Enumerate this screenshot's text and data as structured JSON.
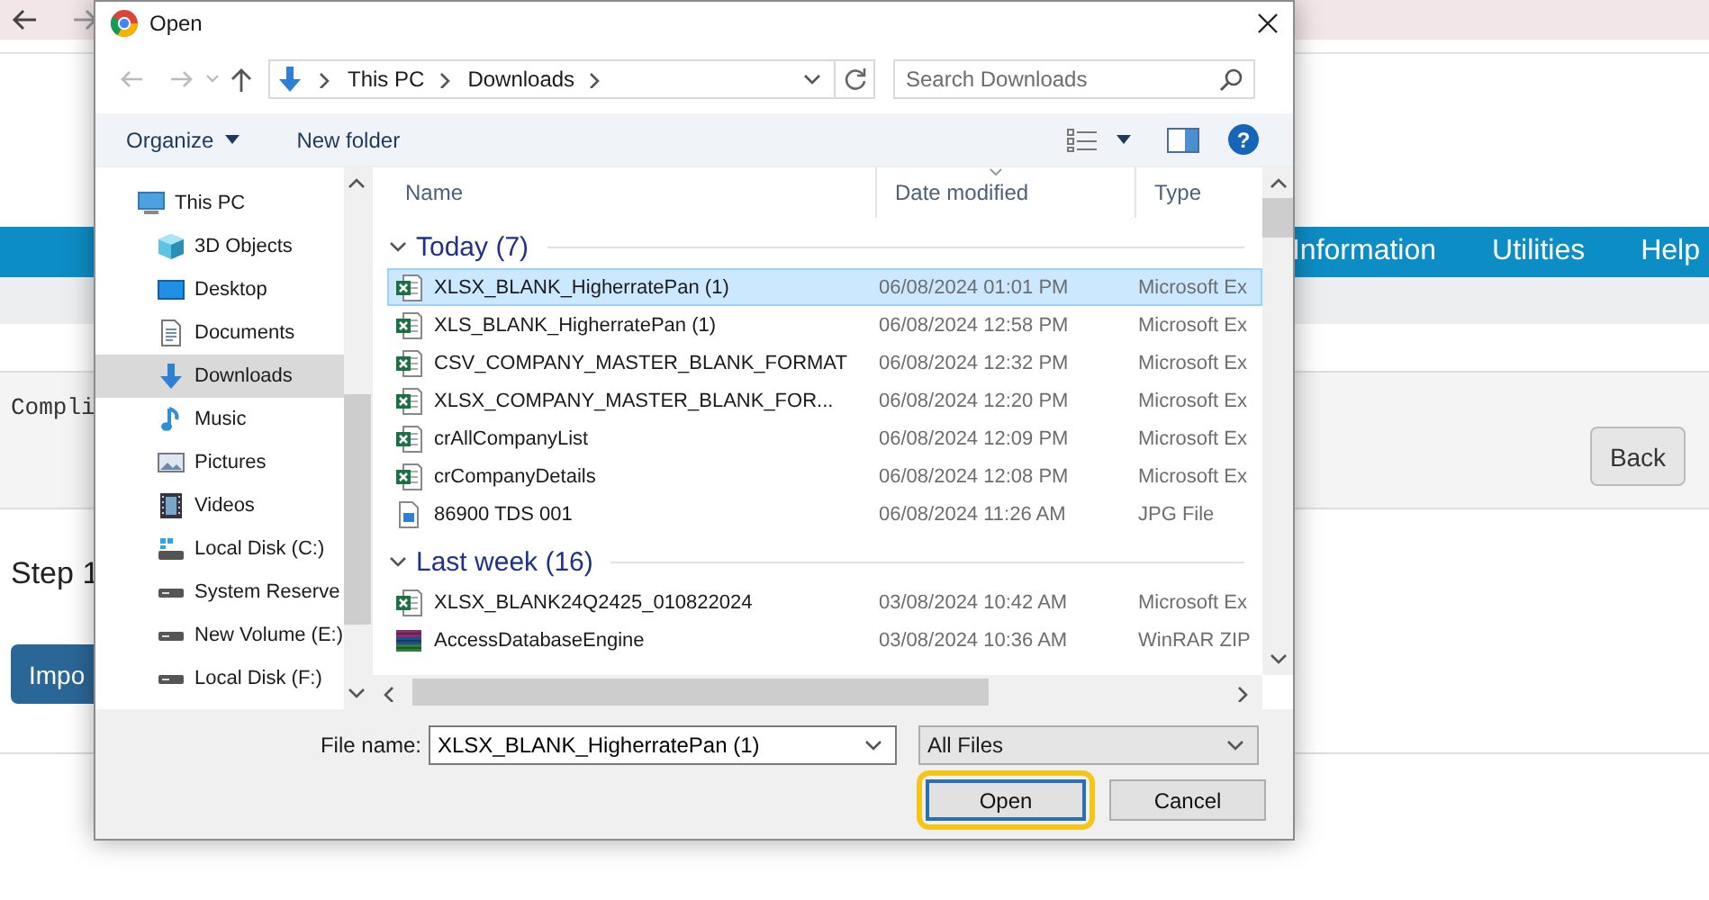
{
  "page": {
    "nav_menu": [
      {
        "label": "Information"
      },
      {
        "label": "Utilities"
      },
      {
        "label": "Help"
      }
    ],
    "panel_text": "Compli",
    "back_button": "Back",
    "step_heading": "Step 1",
    "import_button": "Impo"
  },
  "dialog": {
    "title": "Open",
    "breadcrumb": [
      "This PC",
      "Downloads"
    ],
    "search": {
      "placeholder": "Search Downloads"
    },
    "toolbar": {
      "organize": "Organize",
      "new_folder": "New folder",
      "help": "?"
    },
    "nav_tree": [
      {
        "label": "This PC",
        "kind": "pc",
        "selected": false,
        "children": [
          {
            "label": "3D Objects",
            "kind": "cube",
            "selected": false
          },
          {
            "label": "Desktop",
            "kind": "desktop",
            "selected": false
          },
          {
            "label": "Documents",
            "kind": "documents",
            "selected": false
          },
          {
            "label": "Downloads",
            "kind": "downloads",
            "selected": true
          },
          {
            "label": "Music",
            "kind": "music",
            "selected": false
          },
          {
            "label": "Pictures",
            "kind": "pictures",
            "selected": false
          },
          {
            "label": "Videos",
            "kind": "videos",
            "selected": false
          },
          {
            "label": "Local Disk (C:)",
            "kind": "system-drive",
            "selected": false
          },
          {
            "label": "System Reserve",
            "kind": "drive",
            "selected": false
          },
          {
            "label": "New Volume (E:)",
            "kind": "drive",
            "selected": false
          },
          {
            "label": "Local Disk (F:)",
            "kind": "drive",
            "selected": false
          }
        ]
      }
    ],
    "columns": [
      "Name",
      "Date modified",
      "Type"
    ],
    "groups": [
      {
        "label": "Today (7)",
        "expanded": true,
        "rows": [
          {
            "name": "XLSX_BLANK_HigherratePan (1)",
            "date": "06/08/2024 01:01 PM",
            "type": "Microsoft Ex",
            "kind": "spreadsheet",
            "selected": true
          },
          {
            "name": "XLS_BLANK_HigherratePan (1)",
            "date": "06/08/2024 12:58 PM",
            "type": "Microsoft Ex",
            "kind": "spreadsheet",
            "selected": false
          },
          {
            "name": "CSV_COMPANY_MASTER_BLANK_FORMAT",
            "date": "06/08/2024 12:32 PM",
            "type": "Microsoft Ex",
            "kind": "spreadsheet",
            "selected": false
          },
          {
            "name": "XLSX_COMPANY_MASTER_BLANK_FOR...",
            "date": "06/08/2024 12:20 PM",
            "type": "Microsoft Ex",
            "kind": "spreadsheet",
            "selected": false
          },
          {
            "name": "crAllCompanyList",
            "date": "06/08/2024 12:09 PM",
            "type": "Microsoft Ex",
            "kind": "spreadsheet",
            "selected": false
          },
          {
            "name": "crCompanyDetails",
            "date": "06/08/2024 12:08 PM",
            "type": "Microsoft Ex",
            "kind": "spreadsheet",
            "selected": false
          },
          {
            "name": "86900 TDS 001",
            "date": "06/08/2024 11:26 AM",
            "type": "JPG File",
            "kind": "image",
            "selected": false
          }
        ]
      },
      {
        "label": "Last week (16)",
        "expanded": true,
        "rows": [
          {
            "name": "XLSX_BLANK24Q2425_010822024",
            "date": "03/08/2024 10:42 AM",
            "type": "Microsoft Ex",
            "kind": "spreadsheet",
            "selected": false
          },
          {
            "name": "AccessDatabaseEngine",
            "date": "03/08/2024 10:36 AM",
            "type": "WinRAR ZIP",
            "kind": "archive",
            "selected": false
          }
        ]
      }
    ],
    "file_name": {
      "label": "File name:",
      "value": "XLSX_BLANK_HigherratePan (1)"
    },
    "file_type": "All Files",
    "buttons": [
      {
        "label": "Open",
        "kind": "primary",
        "highlighted": true
      },
      {
        "label": "Cancel",
        "kind": "secondary",
        "highlighted": false
      }
    ]
  }
}
